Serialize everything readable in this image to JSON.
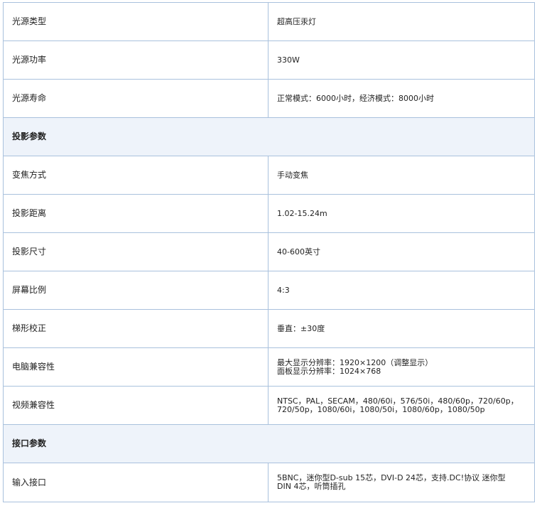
{
  "rows": [
    {
      "type": "row",
      "label": "光源类型",
      "value": [
        "超高压汞灯"
      ]
    },
    {
      "type": "row",
      "label": "光源功率",
      "value": [
        "330W"
      ]
    },
    {
      "type": "row",
      "label": "光源寿命",
      "value": [
        "正常模式：6000小时，经济模式：8000小时"
      ]
    },
    {
      "type": "section",
      "label": "投影参数"
    },
    {
      "type": "row",
      "label": "变焦方式",
      "value": [
        "手动变焦"
      ]
    },
    {
      "type": "row",
      "label": "投影距离",
      "value": [
        "1.02-15.24m"
      ]
    },
    {
      "type": "row",
      "label": "投影尺寸",
      "value": [
        "40-600英寸"
      ]
    },
    {
      "type": "row",
      "label": "屏幕比例",
      "value": [
        "4:3"
      ]
    },
    {
      "type": "row",
      "label": "梯形校正",
      "value": [
        "垂直：±30度"
      ]
    },
    {
      "type": "row",
      "label": "电脑兼容性",
      "value": [
        "最大显示分辨率：1920×1200（调整显示）",
        "面板显示分辨率：1024×768"
      ]
    },
    {
      "type": "row",
      "label": "视频兼容性",
      "value": [
        "NTSC，PAL，SECAM，480/60i，576/50i，480/60p，720/60p，",
        "720/50p，1080/60i，1080/50i，1080/60p，1080/50p"
      ]
    },
    {
      "type": "section",
      "label": "接口参数"
    },
    {
      "type": "row",
      "label": "输入接口",
      "value": [
        "5BNC，迷你型D-sub 15芯，DVI-D 24芯，支持.DC!协议  迷你型",
        "DIN 4芯，听筒插孔"
      ]
    }
  ]
}
